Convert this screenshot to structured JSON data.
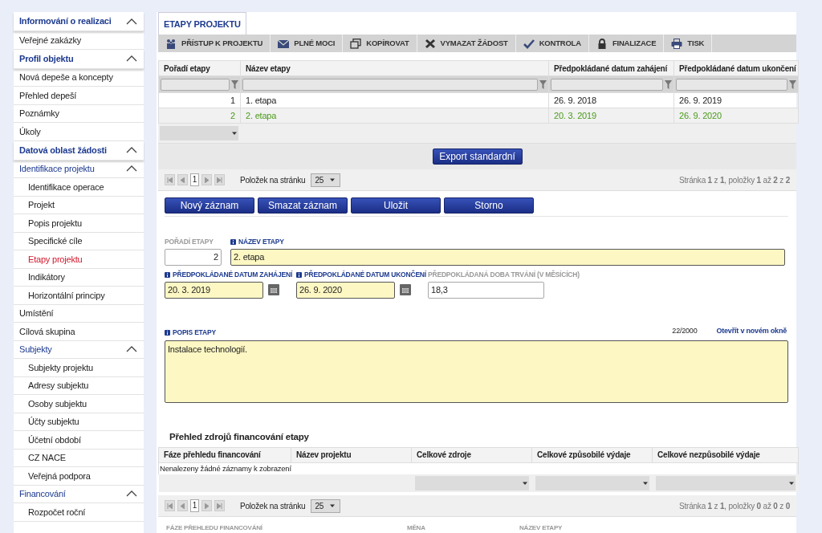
{
  "sidebar": {
    "items": [
      {
        "label": "Informování o realizaci",
        "kind": "section",
        "expanded": true,
        "children": [
          {
            "label": "Veřejné zakázky",
            "kind": "link",
            "selected": false
          }
        ]
      },
      {
        "label": "Profil objektu",
        "kind": "section",
        "expanded": true,
        "children": [
          {
            "label": "Nová depeše a koncepty",
            "kind": "link",
            "selected": false
          },
          {
            "label": "Přehled depeší",
            "kind": "link",
            "selected": false
          },
          {
            "label": "Poznámky",
            "kind": "link",
            "selected": false
          },
          {
            "label": "Úkoly",
            "kind": "link",
            "selected": false
          }
        ]
      },
      {
        "label": "Datová oblast žádosti",
        "kind": "section",
        "expanded": true,
        "children": [
          {
            "label": "Identifikace projektu",
            "kind": "group",
            "expanded": true,
            "children": [
              {
                "label": "Identifikace operace",
                "kind": "link",
                "selected": false
              },
              {
                "label": "Projekt",
                "kind": "link",
                "selected": false
              },
              {
                "label": "Popis projektu",
                "kind": "link",
                "selected": false
              },
              {
                "label": "Specifické cíle",
                "kind": "link",
                "selected": false
              },
              {
                "label": "Etapy projektu",
                "kind": "link",
                "selected": true
              },
              {
                "label": "Indikátory",
                "kind": "link",
                "selected": false
              },
              {
                "label": "Horizontální principy",
                "kind": "link",
                "selected": false
              }
            ]
          },
          {
            "label": "Umístění",
            "kind": "link",
            "selected": false
          },
          {
            "label": "Cílová skupina",
            "kind": "link",
            "selected": false
          },
          {
            "label": "Subjekty",
            "kind": "group",
            "expanded": true,
            "children": [
              {
                "label": "Subjekty projektu",
                "kind": "link",
                "selected": false
              },
              {
                "label": "Adresy subjektu",
                "kind": "link",
                "selected": false
              },
              {
                "label": "Osoby subjektu",
                "kind": "link",
                "selected": false
              },
              {
                "label": "Účty subjektu",
                "kind": "link",
                "selected": false
              },
              {
                "label": "Účetní období",
                "kind": "link",
                "selected": false
              },
              {
                "label": "CZ NACE",
                "kind": "link",
                "selected": false
              },
              {
                "label": "Veřejná podpora",
                "kind": "link",
                "selected": false
              }
            ]
          },
          {
            "label": "Financování",
            "kind": "group",
            "expanded": true,
            "children": [
              {
                "label": "Rozpočet roční",
                "kind": "link",
                "selected": false
              }
            ]
          }
        ]
      }
    ]
  },
  "tabs": [
    {
      "label": "ETAPY PROJEKTU",
      "selected": true
    }
  ],
  "toolbar": [
    {
      "label": "PŘÍSTUP K PROJEKTU",
      "kind": "people"
    },
    {
      "label": "PLNÉ MOCI",
      "kind": "envelope"
    },
    {
      "label": "KOPÍROVAT",
      "kind": "copy"
    },
    {
      "label": "VYMAZAT ŽÁDOST",
      "kind": "cross"
    },
    {
      "label": "KONTROLA",
      "kind": "check"
    },
    {
      "label": "FINALIZACE",
      "kind": "lock"
    },
    {
      "label": "TISK",
      "kind": "printer"
    }
  ],
  "stages_table": {
    "columns": [
      "Pořadí etapy",
      "Název etapy",
      "Předpokládané datum zahájení",
      "Předpokládané datum ukončení"
    ],
    "rows": [
      {
        "cells": [
          "1",
          "1. etapa",
          "26. 9. 2018",
          "26. 9. 2019"
        ],
        "selected": false
      },
      {
        "cells": [
          "2",
          "2. etapa",
          "20. 3. 2019",
          "26. 9. 2020"
        ],
        "selected": true
      }
    ],
    "export_button": "Export standardní",
    "pager": {
      "page": "1",
      "page_size_label": "Položek na stránku",
      "page_size": "25",
      "summary": "Stránka **1** z **1**, položky **1** až **2** z **2**"
    }
  },
  "form_buttons": [
    "Nový záznam",
    "Smazat záznam",
    "Uložit",
    "Storno"
  ],
  "form": {
    "order": {
      "label": "POŘADÍ ETAPY",
      "value": "2",
      "info": false
    },
    "name": {
      "label": "NÁZEV ETAPY",
      "value": "2. etapa",
      "info": true
    },
    "start": {
      "label": "PŘEDPOKLÁDANÉ DATUM ZAHÁJENÍ",
      "value": "20. 3. 2019",
      "info": true
    },
    "end": {
      "label": "PŘEDPOKLÁDANÉ DATUM UKONČENÍ",
      "value": "26. 9. 2020",
      "info": true
    },
    "duration": {
      "label": "PŘEDPOKLÁDANÁ DOBA TRVÁNÍ (V MĚSÍCÍCH)",
      "value": "18,3",
      "info": false
    },
    "description": {
      "label": "POPIS ETAPY",
      "value": "Instalace technologií.",
      "info": true,
      "counter": "22/2000",
      "open_link": "Otevřít v novém okně"
    }
  },
  "financing": {
    "title": "Přehled zdrojů financování etapy",
    "columns": [
      "Fáze přehledu financování",
      "Název projektu",
      "Celkové zdroje",
      "Celkové způsobilé výdaje",
      "Celkové nezpůsobilé výdaje"
    ],
    "empty_text": "Nenalezeny žádné záznamy k zobrazení",
    "pager": {
      "page": "1",
      "page_size_label": "Položek na stránku",
      "page_size": "25",
      "summary": "Stránka **1** z **1**, položky **0** až **0** z **0**"
    }
  },
  "bottom_labels": [
    "FÁZE PŘEHLEDU FINANCOVÁNÍ",
    "MĚNA",
    "NÁZEV ETAPY"
  ]
}
